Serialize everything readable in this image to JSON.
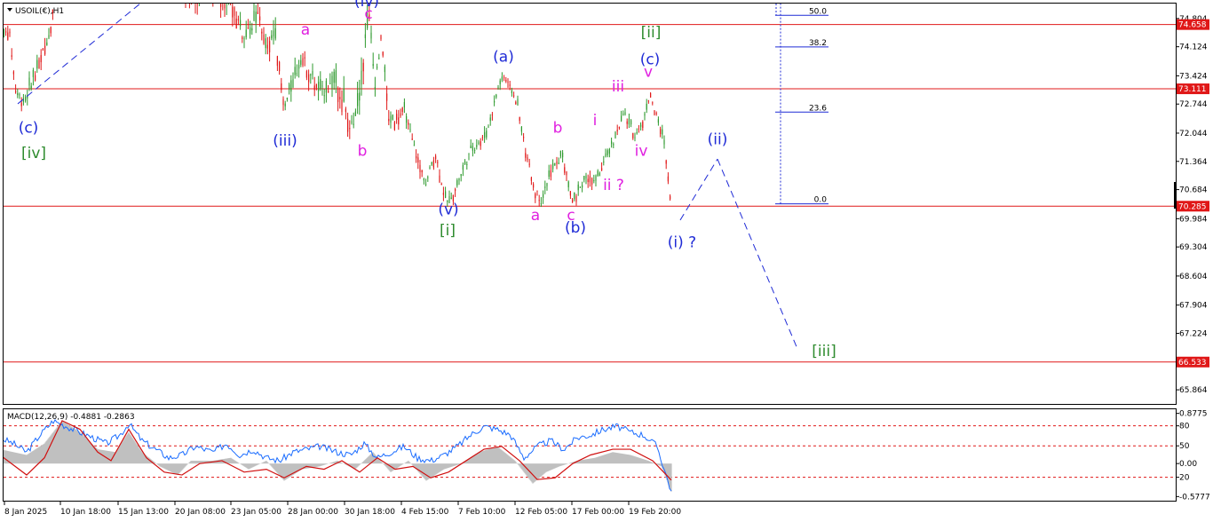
{
  "symbol_label": "USOIL(€),H1",
  "macd_label": "MACD(12,26,9) -0.4881 -0.2863",
  "colors": {
    "bull": "#2e9a2e",
    "bear": "#e01818",
    "level": "#e01818",
    "blue": "#1f2bd6",
    "magenta": "#e020e0",
    "green": "#2e8b2e",
    "macd_hist": "#c0c0c0",
    "macd_line": "#1a6cff",
    "signal_line": "#d01010"
  },
  "chart_data": [
    {
      "type": "line",
      "title": "",
      "ylim": [
        65.524,
        75.164
      ],
      "y_tick_labels": [
        "74.804",
        "74.124",
        "73.424",
        "72.744",
        "72.044",
        "71.364",
        "70.684",
        "69.984",
        "69.304",
        "68.604",
        "67.904",
        "67.224",
        "66.544",
        "65.864"
      ],
      "y_ticks": [
        74.804,
        74.124,
        73.424,
        72.744,
        72.044,
        71.364,
        70.684,
        69.984,
        69.304,
        68.604,
        67.904,
        67.224,
        66.544,
        65.864
      ],
      "x_tick_labels": [
        "8 Jan 2025",
        "10 Jan 18:00",
        "15 Jan 13:00",
        "20 Jan 08:00",
        "23 Jan 05:00",
        "28 Jan 00:00",
        "30 Jan 18:00",
        "4 Feb 15:00",
        "7 Feb 10:00",
        "12 Feb 05:00",
        "17 Feb 00:00",
        "19 Feb 20:00"
      ],
      "horizontal_levels": [
        {
          "value": 74.658,
          "label": "74.658"
        },
        {
          "value": 73.111,
          "label": "73.111"
        },
        {
          "value": 70.285,
          "label": "70.285"
        },
        {
          "value": 66.533,
          "label": "66.533"
        }
      ],
      "fibonacci": [
        {
          "label": "50.0",
          "value": 74.88
        },
        {
          "label": "38.2",
          "value": 74.12
        },
        {
          "label": "23.6",
          "value": 72.55
        },
        {
          "label": "0.0",
          "value": 70.34
        }
      ],
      "price_path": [
        [
          0,
          74.2
        ],
        [
          10,
          74.6
        ],
        [
          18,
          73.0
        ],
        [
          28,
          72.8
        ],
        [
          40,
          73.5
        ],
        [
          55,
          74.4
        ],
        [
          62,
          75.4
        ],
        [
          75,
          76.0
        ],
        [
          110,
          76.2
        ],
        [
          160,
          75.8
        ],
        [
          200,
          75.6
        ],
        [
          222,
          75.3
        ],
        [
          240,
          75.6
        ],
        [
          262,
          75.2
        ],
        [
          275,
          74.3
        ],
        [
          292,
          74.9
        ],
        [
          300,
          74.0
        ],
        [
          310,
          74.5
        ],
        [
          320,
          72.6
        ],
        [
          340,
          73.9
        ],
        [
          360,
          73.0
        ],
        [
          380,
          73.3
        ],
        [
          395,
          72.1
        ],
        [
          405,
          73.0
        ],
        [
          415,
          75.0
        ],
        [
          422,
          73.2
        ],
        [
          430,
          74.4
        ],
        [
          438,
          72.3
        ],
        [
          455,
          72.6
        ],
        [
          465,
          71.8
        ],
        [
          480,
          70.8
        ],
        [
          490,
          71.6
        ],
        [
          503,
          70.3
        ],
        [
          515,
          70.8
        ],
        [
          530,
          71.6
        ],
        [
          548,
          72.0
        ],
        [
          562,
          73.2
        ],
        [
          568,
          73.4
        ],
        [
          582,
          72.8
        ],
        [
          592,
          71.6
        ],
        [
          602,
          70.7
        ],
        [
          610,
          70.4
        ],
        [
          620,
          71.1
        ],
        [
          634,
          71.5
        ],
        [
          640,
          70.8
        ],
        [
          646,
          70.4
        ],
        [
          660,
          71.0
        ],
        [
          672,
          70.9
        ],
        [
          690,
          71.8
        ],
        [
          703,
          72.5
        ],
        [
          715,
          72.0
        ],
        [
          724,
          72.3
        ],
        [
          732,
          73.0
        ],
        [
          740,
          72.4
        ],
        [
          748,
          71.8
        ],
        [
          756,
          70.35
        ]
      ],
      "bands": [
        [
          0,
          0.35
        ],
        [
          50,
          0.5
        ],
        [
          100,
          0.3
        ],
        [
          150,
          0.4
        ],
        [
          200,
          0.45
        ],
        [
          240,
          0.7
        ],
        [
          275,
          0.55
        ],
        [
          310,
          0.6
        ],
        [
          350,
          0.5
        ],
        [
          410,
          0.8
        ],
        [
          440,
          0.45
        ],
        [
          480,
          0.35
        ],
        [
          530,
          0.35
        ],
        [
          570,
          0.3
        ],
        [
          610,
          0.35
        ],
        [
          650,
          0.35
        ],
        [
          700,
          0.3
        ],
        [
          756,
          0.3
        ]
      ],
      "projection": [
        {
          "name": "wave-(i)-to-(ii)",
          "points": [
            [
              766,
              69.95
            ],
            [
              808,
              71.42
            ]
          ]
        },
        {
          "name": "wave-(ii)-to-[iii]",
          "points": [
            [
              808,
              71.42
            ],
            [
              898,
              66.85
            ]
          ]
        },
        {
          "name": "trendline",
          "points": [
            [
              20,
              72.75
            ],
            [
              160,
              75.2
            ]
          ]
        }
      ],
      "wave_labels": [
        {
          "text": "(c)",
          "x": 32,
          "y": 72.05,
          "color": "blue"
        },
        {
          "text": "[iv]",
          "x": 38,
          "y": 71.45,
          "color": "green"
        },
        {
          "text": "a",
          "x": 344,
          "y": 74.42,
          "color": "magenta"
        },
        {
          "text": "(iv)",
          "x": 413,
          "y": 75.1,
          "color": "blue"
        },
        {
          "text": "c",
          "x": 415,
          "y": 74.8,
          "color": "magenta"
        },
        {
          "text": "(iii)",
          "x": 321,
          "y": 71.74,
          "color": "blue"
        },
        {
          "text": "b",
          "x": 408,
          "y": 71.5,
          "color": "magenta"
        },
        {
          "text": "(a)",
          "x": 567,
          "y": 73.76,
          "color": "blue"
        },
        {
          "text": "b",
          "x": 628,
          "y": 72.05,
          "color": "magenta"
        },
        {
          "text": "i",
          "x": 670,
          "y": 72.24,
          "color": "magenta"
        },
        {
          "text": "[ii]",
          "x": 733,
          "y": 74.35,
          "color": "green"
        },
        {
          "text": "(c)",
          "x": 732,
          "y": 73.7,
          "color": "blue"
        },
        {
          "text": "v",
          "x": 730,
          "y": 73.4,
          "color": "magenta"
        },
        {
          "text": "iii",
          "x": 696,
          "y": 73.05,
          "color": "magenta"
        },
        {
          "text": "iv",
          "x": 722,
          "y": 71.5,
          "color": "magenta"
        },
        {
          "text": "ii ?",
          "x": 691,
          "y": 70.68,
          "color": "magenta"
        },
        {
          "text": "(v)",
          "x": 505,
          "y": 70.09,
          "color": "blue"
        },
        {
          "text": "[i]",
          "x": 504,
          "y": 69.58,
          "color": "green"
        },
        {
          "text": "a",
          "x": 603,
          "y": 69.95,
          "color": "magenta"
        },
        {
          "text": "c",
          "x": 643,
          "y": 69.95,
          "color": "magenta"
        },
        {
          "text": "(b)",
          "x": 648,
          "y": 69.65,
          "color": "blue"
        },
        {
          "text": "(ii)",
          "x": 808,
          "y": 71.78,
          "color": "blue"
        },
        {
          "text": "(i) ?",
          "x": 768,
          "y": 69.3,
          "color": "blue"
        },
        {
          "text": "[iii]",
          "x": 928,
          "y": 66.68,
          "color": "green"
        }
      ]
    },
    {
      "type": "line",
      "title": "MACD(12,26,9) -0.4881 -0.2863",
      "ylim": [
        -0.65,
        0.95
      ],
      "y_tick_labels": [
        "0.8775",
        "80",
        "50",
        "0.00",
        "20",
        "-0.5777"
      ],
      "y_ticks": [
        0.8775,
        0.66,
        0.31,
        0.0,
        -0.24,
        -0.5777
      ],
      "levels": [
        0.66,
        0.31,
        -0.24
      ],
      "series": [
        {
          "key": "histogram",
          "points": [
            [
              0,
              0.25
            ],
            [
              30,
              0.15
            ],
            [
              50,
              0.35
            ],
            [
              70,
              0.75
            ],
            [
              90,
              0.55
            ],
            [
              110,
              0.25
            ],
            [
              130,
              0.2
            ],
            [
              145,
              0.55
            ],
            [
              160,
              0.2
            ],
            [
              180,
              -0.05
            ],
            [
              200,
              -0.2
            ],
            [
              215,
              0.05
            ],
            [
              240,
              0.05
            ],
            [
              260,
              0.1
            ],
            [
              280,
              -0.1
            ],
            [
              300,
              0.05
            ],
            [
              320,
              -0.3
            ],
            [
              340,
              -0.1
            ],
            [
              360,
              -0.05
            ],
            [
              380,
              0.05
            ],
            [
              400,
              -0.1
            ],
            [
              420,
              0.2
            ],
            [
              440,
              -0.15
            ],
            [
              460,
              0.05
            ],
            [
              480,
              -0.3
            ],
            [
              500,
              -0.1
            ],
            [
              520,
              0.0
            ],
            [
              540,
              0.2
            ],
            [
              560,
              0.3
            ],
            [
              580,
              0.05
            ],
            [
              600,
              -0.35
            ],
            [
              615,
              -0.15
            ],
            [
              630,
              -0.05
            ],
            [
              650,
              0.05
            ],
            [
              670,
              0.1
            ],
            [
              690,
              0.2
            ],
            [
              710,
              0.15
            ],
            [
              730,
              0.05
            ],
            [
              745,
              -0.05
            ],
            [
              756,
              -0.49
            ]
          ]
        },
        {
          "key": "signal",
          "points": [
            [
              0,
              0.15
            ],
            [
              30,
              -0.2
            ],
            [
              50,
              0.1
            ],
            [
              70,
              0.75
            ],
            [
              90,
              0.6
            ],
            [
              110,
              0.2
            ],
            [
              125,
              0.05
            ],
            [
              145,
              0.6
            ],
            [
              165,
              0.1
            ],
            [
              185,
              -0.15
            ],
            [
              205,
              -0.2
            ],
            [
              225,
              0.0
            ],
            [
              250,
              0.05
            ],
            [
              275,
              -0.15
            ],
            [
              300,
              -0.1
            ],
            [
              320,
              -0.25
            ],
            [
              345,
              -0.05
            ],
            [
              365,
              -0.1
            ],
            [
              385,
              0.05
            ],
            [
              405,
              -0.15
            ],
            [
              425,
              0.1
            ],
            [
              445,
              -0.1
            ],
            [
              465,
              -0.05
            ],
            [
              485,
              -0.25
            ],
            [
              505,
              -0.15
            ],
            [
              525,
              0.05
            ],
            [
              545,
              0.25
            ],
            [
              565,
              0.3
            ],
            [
              585,
              0.05
            ],
            [
              605,
              -0.28
            ],
            [
              625,
              -0.25
            ],
            [
              645,
              0.0
            ],
            [
              665,
              0.15
            ],
            [
              690,
              0.25
            ],
            [
              710,
              0.25
            ],
            [
              735,
              0.05
            ],
            [
              756,
              -0.29
            ]
          ]
        },
        {
          "key": "macd",
          "points": [
            [
              0,
              0.45
            ],
            [
              15,
              0.35
            ],
            [
              30,
              0.2
            ],
            [
              45,
              0.5
            ],
            [
              60,
              0.75
            ],
            [
              75,
              0.65
            ],
            [
              90,
              0.55
            ],
            [
              105,
              0.45
            ],
            [
              120,
              0.35
            ],
            [
              135,
              0.5
            ],
            [
              145,
              0.7
            ],
            [
              160,
              0.4
            ],
            [
              175,
              0.25
            ],
            [
              190,
              0.1
            ],
            [
              205,
              0.15
            ],
            [
              220,
              0.3
            ],
            [
              240,
              0.2
            ],
            [
              255,
              0.35
            ],
            [
              270,
              0.15
            ],
            [
              285,
              0.25
            ],
            [
              300,
              0.1
            ],
            [
              315,
              0.05
            ],
            [
              330,
              0.2
            ],
            [
              345,
              0.25
            ],
            [
              360,
              0.3
            ],
            [
              380,
              0.2
            ],
            [
              395,
              0.15
            ],
            [
              410,
              0.35
            ],
            [
              425,
              0.1
            ],
            [
              440,
              0.2
            ],
            [
              455,
              0.3
            ],
            [
              470,
              0.1
            ],
            [
              485,
              0.05
            ],
            [
              500,
              0.15
            ],
            [
              515,
              0.3
            ],
            [
              530,
              0.5
            ],
            [
              545,
              0.65
            ],
            [
              560,
              0.6
            ],
            [
              575,
              0.5
            ],
            [
              590,
              0.1
            ],
            [
              605,
              0.3
            ],
            [
              620,
              0.4
            ],
            [
              635,
              0.25
            ],
            [
              650,
              0.45
            ],
            [
              665,
              0.5
            ],
            [
              680,
              0.6
            ],
            [
              695,
              0.65
            ],
            [
              710,
              0.55
            ],
            [
              725,
              0.5
            ],
            [
              740,
              0.3
            ],
            [
              756,
              -0.49
            ]
          ]
        }
      ]
    }
  ]
}
